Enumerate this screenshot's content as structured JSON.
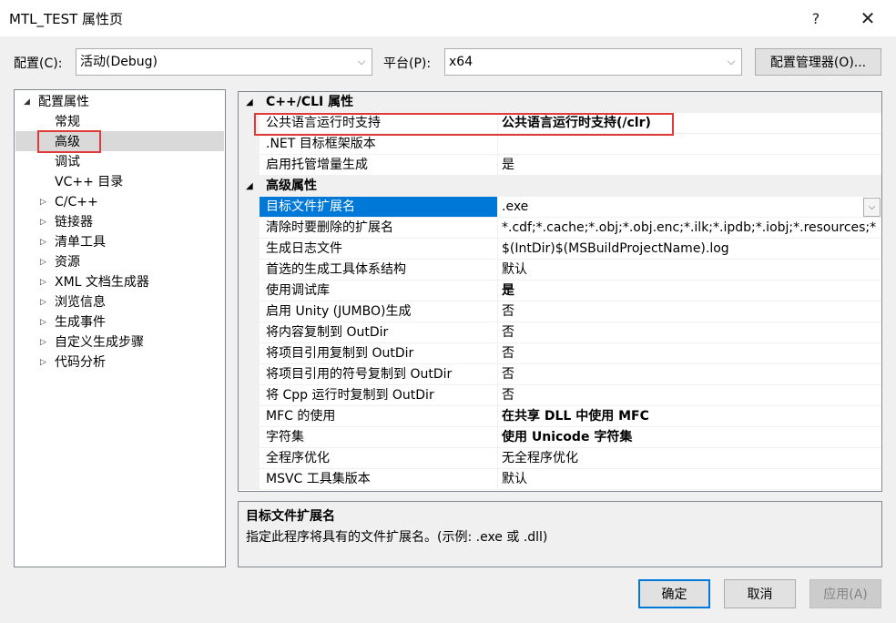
{
  "window": {
    "title": "MTL_TEST 属性页",
    "help": "?",
    "close": "✕"
  },
  "config": {
    "label": "配置(C):",
    "value": "活动(Debug)",
    "platform_label": "平台(P):",
    "platform_value": "x64",
    "manager_button": "配置管理器(O)..."
  },
  "tree": {
    "root": "配置属性",
    "items": [
      "常规",
      "高级",
      "调试",
      "VC++ 目录",
      "C/C++",
      "链接器",
      "清单工具",
      "资源",
      "XML 文档生成器",
      "浏览信息",
      "生成事件",
      "自定义生成步骤",
      "代码分析"
    ],
    "selected": "高级"
  },
  "grid": {
    "categories": [
      {
        "title": "C++/CLI 属性",
        "rows": [
          {
            "name": "公共语言运行时支持",
            "value": "公共语言运行时支持(/clr)",
            "bold": true
          },
          {
            "name": ".NET 目标框架版本",
            "value": "",
            "bold": false
          },
          {
            "name": "启用托管增量生成",
            "value": "是",
            "bold": false
          }
        ]
      },
      {
        "title": "高级属性",
        "rows": [
          {
            "name": "目标文件扩展名",
            "value": ".exe",
            "bold": false
          },
          {
            "name": "清除时要删除的扩展名",
            "value": "*.cdf;*.cache;*.obj;*.obj.enc;*.ilk;*.ipdb;*.iobj;*.resources;*",
            "bold": false
          },
          {
            "name": "生成日志文件",
            "value": "$(IntDir)$(MSBuildProjectName).log",
            "bold": false
          },
          {
            "name": "首选的生成工具体系结构",
            "value": "默认",
            "bold": false
          },
          {
            "name": "使用调试库",
            "value": "是",
            "bold": true
          },
          {
            "name": "启用 Unity (JUMBO)生成",
            "value": "否",
            "bold": false
          },
          {
            "name": "将内容复制到 OutDir",
            "value": "否",
            "bold": false
          },
          {
            "name": "将项目引用复制到 OutDir",
            "value": "否",
            "bold": false
          },
          {
            "name": "将项目引用的符号复制到 OutDir",
            "value": "否",
            "bold": false
          },
          {
            "name": "将 Cpp 运行时复制到 OutDir",
            "value": "否",
            "bold": false
          },
          {
            "name": "MFC 的使用",
            "value": "在共享 DLL 中使用 MFC",
            "bold": true
          },
          {
            "name": "字符集",
            "value": "使用 Unicode 字符集",
            "bold": true
          },
          {
            "name": "全程序优化",
            "value": "无全程序优化",
            "bold": false
          },
          {
            "name": "MSVC 工具集版本",
            "value": "默认",
            "bold": false
          }
        ]
      }
    ]
  },
  "description": {
    "title": "目标文件扩展名",
    "text": "指定此程序将具有的文件扩展名。(示例: .exe 或 .dll)"
  },
  "buttons": {
    "ok": "确定",
    "cancel": "取消",
    "apply": "应用(A)"
  },
  "colors": {
    "selection": "#0078d7",
    "highlight_box": "#e03a3a"
  }
}
